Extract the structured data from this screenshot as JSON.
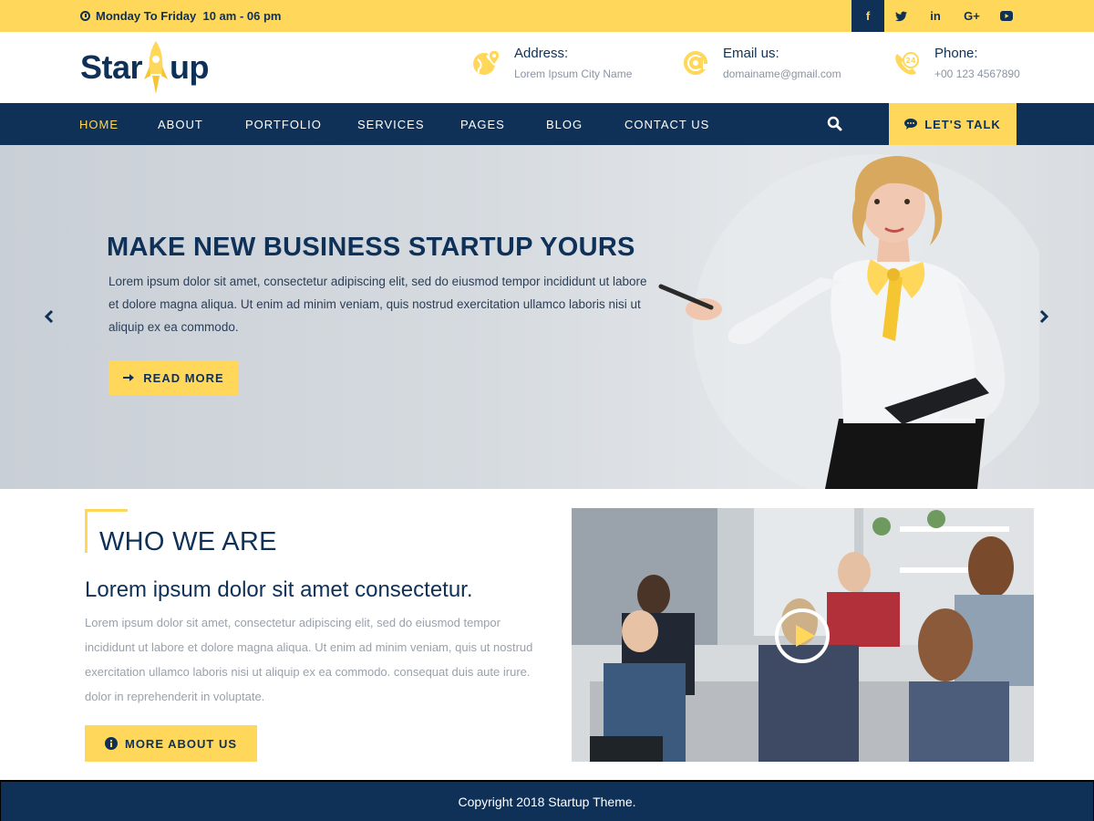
{
  "topbar": {
    "hours": "Monday To Friday  10 am - 06 pm",
    "socials": [
      "f",
      "t",
      "in",
      "G+",
      "yt"
    ]
  },
  "brand": {
    "logo_left": "Star",
    "logo_right": "up"
  },
  "contact": {
    "address_label": "Address:",
    "address_value": "Lorem Ipsum City Name",
    "email_label": "Email us:",
    "email_value": "domainame@gmail.com",
    "phone_label": "Phone:",
    "phone_value": "+00 123 4567890"
  },
  "nav": {
    "items": [
      "HOME",
      "ABOUT",
      "PORTFOLIO",
      "SERVICES",
      "PAGES",
      "BLOG",
      "CONTACT US"
    ],
    "cta": "LET'S TALK"
  },
  "hero": {
    "title": "MAKE NEW BUSINESS STARTUP YOURS",
    "text": "Lorem ipsum dolor sit amet, consectetur adipiscing elit, sed do eiusmod tempor incididunt ut labore et dolore magna aliqua. Ut enim ad minim veniam, quis nostrud exercitation ullamco laboris nisi ut aliquip ex ea commodo.",
    "button": "READ MORE"
  },
  "about": {
    "title": "WHO WE ARE",
    "subtitle": "Lorem ipsum dolor sit amet consectetur.",
    "text": "Lorem ipsum dolor sit amet, consectetur adipiscing elit, sed do eiusmod tempor incididunt ut labore et dolore magna aliqua. Ut enim ad minim veniam, quis ut nostrud exercitation ullamco laboris nisi ut aliquip ex ea commodo. consequat duis aute irure. dolor in reprehenderit in voluptate.",
    "button": "MORE ABOUT US"
  },
  "footer": {
    "copyright": "Copyright 2018 Startup Theme."
  },
  "colors": {
    "navy": "#0f3057",
    "yellow": "#ffd75a"
  }
}
